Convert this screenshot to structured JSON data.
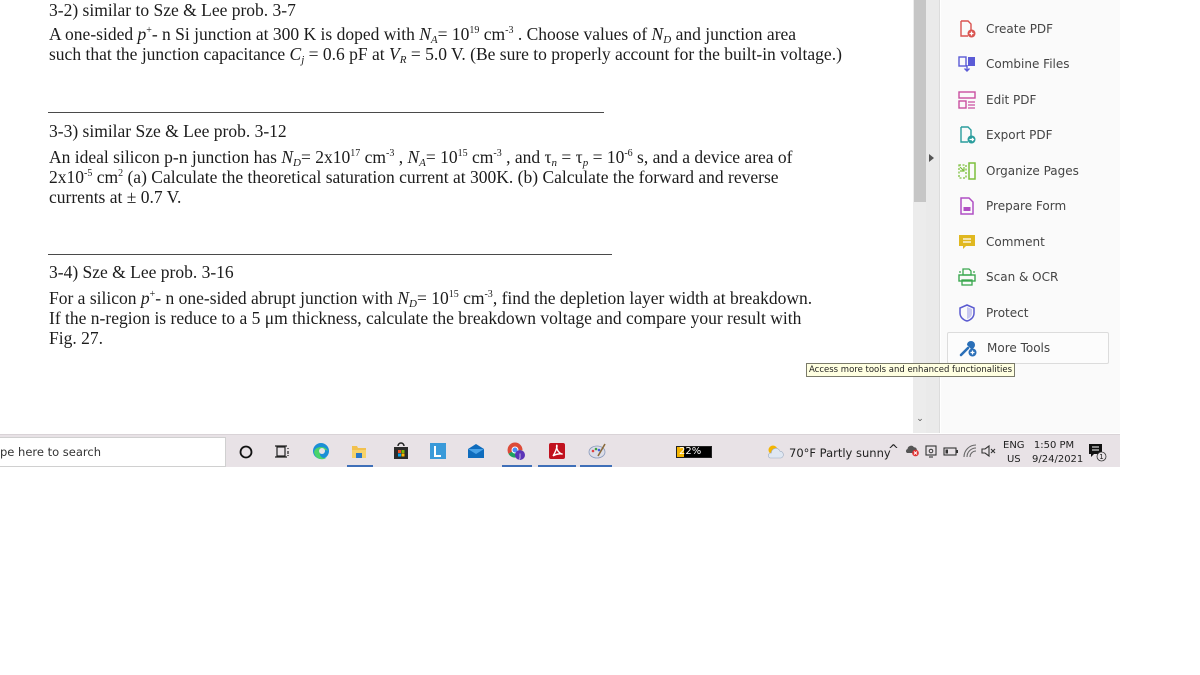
{
  "document": {
    "problems": [
      {
        "heading": "3-2) similar to Sze & Lee prob. 3-7",
        "lines": [
          [
            "A one-sided ",
            {
              "i": "p"
            },
            {
              "sup": "+"
            },
            "- n Si junction at 300 K is doped with ",
            {
              "i": "N"
            },
            {
              "sub": "A"
            },
            "= 10",
            {
              "sup": "19"
            },
            " cm",
            {
              "sup": "-3"
            },
            " .  Choose values of ",
            {
              "i": "N"
            },
            {
              "sub": "D"
            },
            " and junction area"
          ],
          [
            "such that the junction capacitance ",
            {
              "i": "C"
            },
            {
              "sub": "j"
            },
            " = 0.6 pF at ",
            {
              "i": "V"
            },
            {
              "sub": "R"
            },
            " = 5.0 V.  (Be sure to properly account for the built-in voltage.)"
          ]
        ]
      },
      {
        "heading": "3-3) similar Sze & Lee prob. 3-12",
        "lines": [
          [
            "An ideal silicon p-n junction has ",
            {
              "i": "N"
            },
            {
              "sub": "D"
            },
            "= 2x10",
            {
              "sup": "17"
            },
            " cm",
            {
              "sup": "-3"
            },
            " , ",
            {
              "i": "N"
            },
            {
              "sub": "A"
            },
            "= 10",
            {
              "sup": "15"
            },
            " cm",
            {
              "sup": "-3"
            },
            " , and τ",
            {
              "sub": "n"
            },
            " = τ",
            {
              "sub": "p"
            },
            " = 10",
            {
              "sup": "-6"
            },
            " s, and a device area of"
          ],
          [
            "2x10",
            {
              "sup": "-5"
            },
            " cm",
            {
              "sup": "2"
            },
            "  (a) Calculate the theoretical saturation current at 300K.  (b) Calculate the forward and reverse"
          ],
          [
            "currents at ± 0.7 V."
          ]
        ]
      },
      {
        "heading": "3-4) Sze & Lee prob. 3-16",
        "lines": [
          [
            "For a silicon ",
            {
              "i": "p"
            },
            {
              "sup": "+"
            },
            "- n one-sided abrupt junction with ",
            {
              "i": "N"
            },
            {
              "sub": "D"
            },
            "= 10",
            {
              "sup": "15"
            },
            " cm",
            {
              "sup": "-3"
            },
            ", find the depletion layer width at breakdown."
          ],
          [
            "If the n-region is reduce to a 5 μm thickness, calculate the breakdown voltage and compare your result with"
          ],
          [
            "Fig. 27."
          ]
        ]
      }
    ]
  },
  "tools_pane": {
    "items": [
      {
        "label": "Create PDF",
        "icon": "create-pdf-icon",
        "color": "#d9534f"
      },
      {
        "label": "Combine Files",
        "icon": "combine-files-icon",
        "color": "#5b5bd6"
      },
      {
        "label": "Edit PDF",
        "icon": "edit-pdf-icon",
        "color": "#c94fa0"
      },
      {
        "label": "Export PDF",
        "icon": "export-pdf-icon",
        "color": "#2a9d9d"
      },
      {
        "label": "Organize Pages",
        "icon": "organize-pages-icon",
        "color": "#7cbf3c"
      },
      {
        "label": "Prepare Form",
        "icon": "prepare-form-icon",
        "color": "#b04fc4"
      },
      {
        "label": "Comment",
        "icon": "comment-icon",
        "color": "#e0b820"
      },
      {
        "label": "Scan & OCR",
        "icon": "scan-ocr-icon",
        "color": "#3aa84f"
      },
      {
        "label": "Protect",
        "icon": "protect-icon",
        "color": "#5a5ad0"
      },
      {
        "label": "More Tools",
        "icon": "more-tools-icon",
        "color": "#2a6fb8"
      }
    ],
    "tooltip": "Access more tools and enhanced functionalities"
  },
  "taskbar": {
    "search_placeholder": "pe here to search",
    "battery_percent": 22,
    "battery_label": "22%",
    "weather": "70°F  Partly sunny",
    "language_top": "ENG",
    "language_bottom": "US",
    "time": "1:50 PM",
    "date": "9/24/2021",
    "notification_count": "1",
    "apps": [
      "cortana",
      "task-view",
      "edge",
      "file-explorer",
      "microsoft-store",
      "lync",
      "mail",
      "chrome",
      "acrobat",
      "paint"
    ]
  }
}
